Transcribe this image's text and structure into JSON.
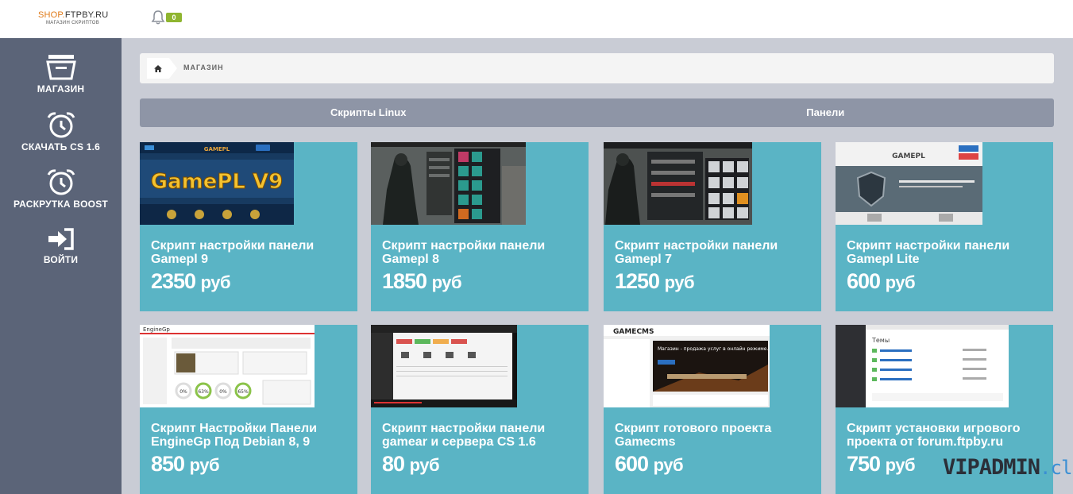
{
  "header": {
    "logo_brand": "SHOP.",
    "logo_domain": "FTPBY.RU",
    "logo_sub": "МАГАЗИН СКРИПТОВ",
    "notifications_count": "0"
  },
  "sidebar": {
    "items": [
      {
        "label": "МАГАЗИН",
        "icon": "basket-icon"
      },
      {
        "label": "СКАЧАТЬ CS 1.6",
        "icon": "alarm-clock-icon"
      },
      {
        "label": "РАСКРУТКА BOOST",
        "icon": "alarm-clock-icon"
      },
      {
        "label": "ВОЙТИ",
        "icon": "sign-in-icon"
      }
    ]
  },
  "breadcrumb": {
    "home_icon": "home-icon",
    "current": "МАГАЗИН"
  },
  "tabs": [
    {
      "label": "Скрипты Linux"
    },
    {
      "label": "Панели"
    }
  ],
  "products": [
    {
      "title": "Скрипт настройки панели Gamepl 9",
      "price": "2350",
      "currency": "руб"
    },
    {
      "title": "Скрипт настройки панели Gamepl 8",
      "price": "1850",
      "currency": "руб"
    },
    {
      "title": "Скрипт настройки панели Gamepl 7",
      "price": "1250",
      "currency": "руб"
    },
    {
      "title": "Скрипт настройки панели Gamepl Lite",
      "price": "600",
      "currency": "руб"
    },
    {
      "title": "Скрипт Настройки Панели EngineGp Под Debian 8, 9",
      "price": "850",
      "currency": "руб"
    },
    {
      "title": "Скрипт настройки панели gamear и сервера CS 1.6",
      "price": "80",
      "currency": "руб"
    },
    {
      "title": "Скрипт готового проекта Gamecms",
      "price": "600",
      "currency": "руб"
    },
    {
      "title": "Скрипт установки игрового проекта от forum.ftpby.ru",
      "price": "750",
      "currency": "руб"
    }
  ],
  "thumbnails": {
    "t0_logo": "GAMEPL",
    "t0_banner": "GamePL V9",
    "t3_logo": "GAMEPL",
    "t4_brand": "EngineGp",
    "t4_g1": "0%",
    "t4_g2": "63%",
    "t4_g3": "0%",
    "t4_g4": "65%",
    "t6_brand": "GAMECMS",
    "t6_banner": "Магазин - продажа услуг в онлайн режиме.",
    "t7_heading": "Темы"
  },
  "watermark": {
    "main": "VIPADMIN",
    "suffix": ".club"
  },
  "colors": {
    "card": "#5ab4c5",
    "sidebar": "#5b6478",
    "tabs": "#8e95a6",
    "badge": "#8fb530",
    "logo_accent": "#e07b1a"
  }
}
